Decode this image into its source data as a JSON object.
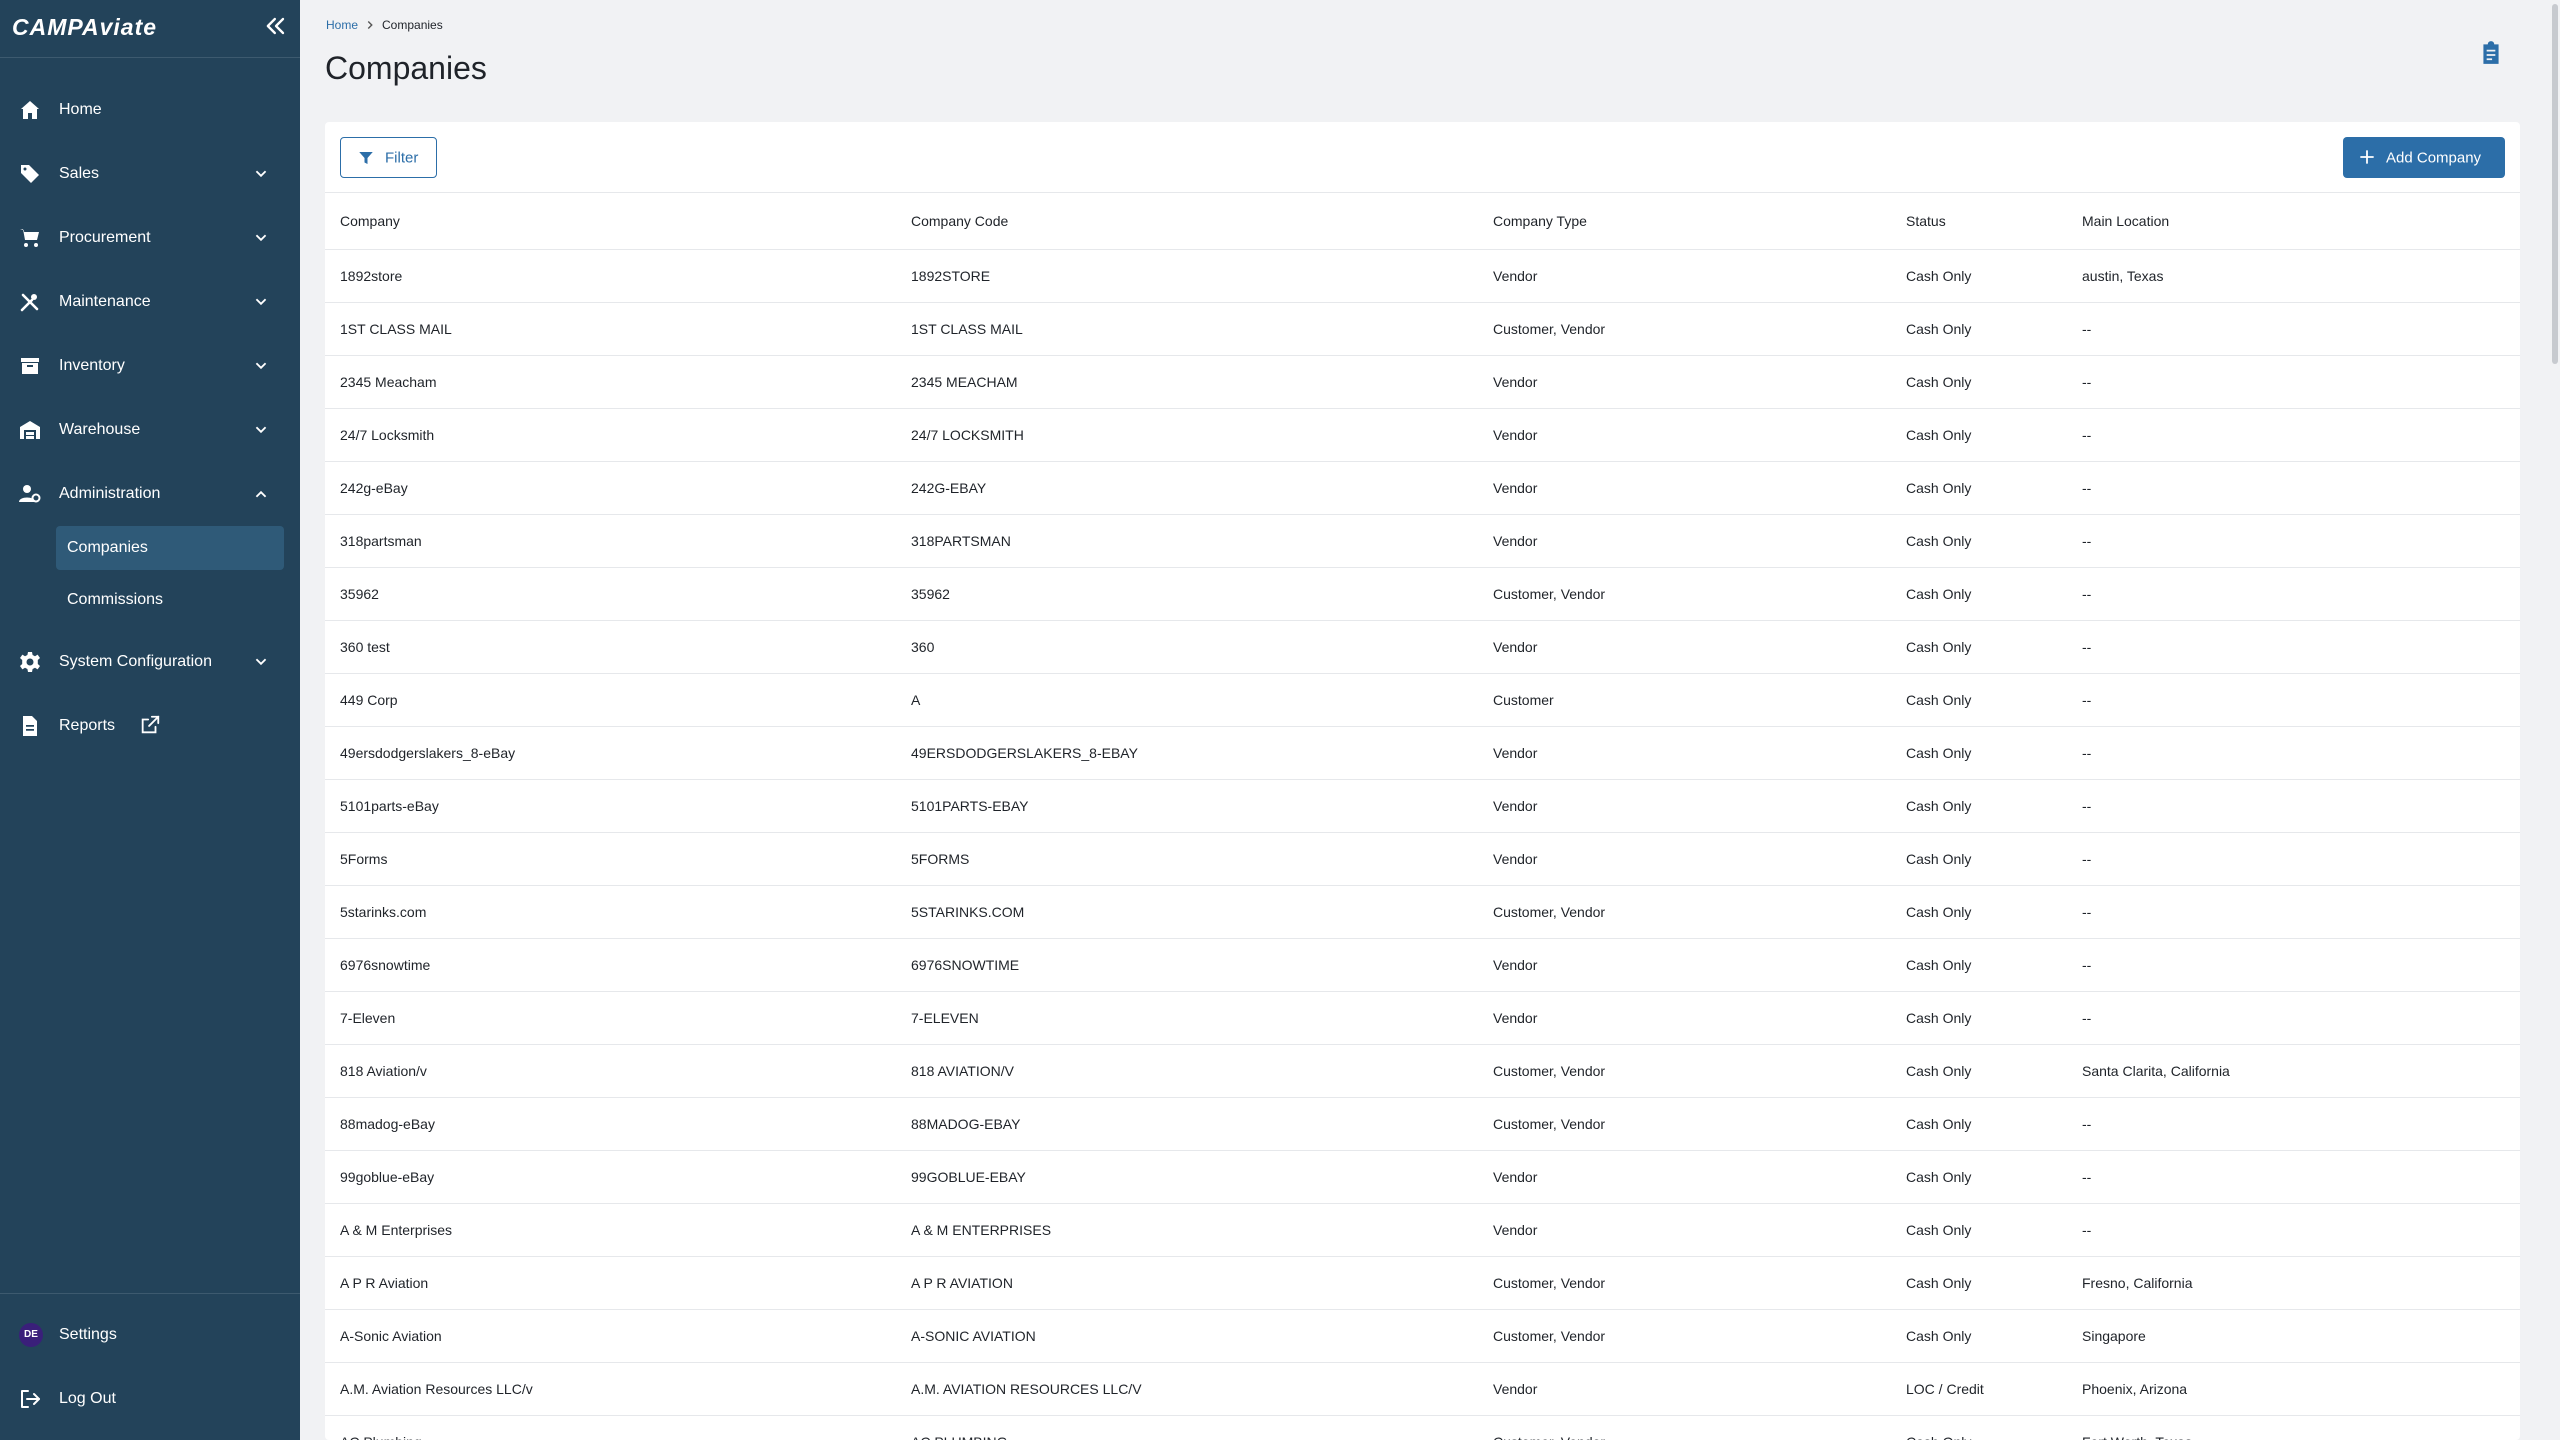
{
  "sidebar": {
    "logo": "CAMPAviate",
    "items": [
      {
        "label": "Home",
        "icon": "home-icon",
        "has_children": false
      },
      {
        "label": "Sales",
        "icon": "tag-icon",
        "has_children": true
      },
      {
        "label": "Procurement",
        "icon": "cart-icon",
        "has_children": true
      },
      {
        "label": "Maintenance",
        "icon": "tools-icon",
        "has_children": true
      },
      {
        "label": "Inventory",
        "icon": "archive-icon",
        "has_children": true
      },
      {
        "label": "Warehouse",
        "icon": "warehouse-icon",
        "has_children": true
      },
      {
        "label": "Administration",
        "icon": "admin-icon",
        "has_children": true,
        "expanded": true,
        "children": [
          {
            "label": "Companies",
            "active": true
          },
          {
            "label": "Commissions",
            "active": false
          }
        ]
      },
      {
        "label": "System Configuration",
        "icon": "gear-icon",
        "has_children": true
      },
      {
        "label": "Reports",
        "icon": "document-icon",
        "external": true
      }
    ],
    "bottom": [
      {
        "label": "Settings",
        "avatar_initials": "DE"
      },
      {
        "label": "Log Out",
        "icon": "logout-icon"
      }
    ]
  },
  "breadcrumb": {
    "home": "Home",
    "current": "Companies"
  },
  "page_title": "Companies",
  "toolbar": {
    "filter_label": "Filter",
    "add_label": "Add Company"
  },
  "table": {
    "headers": [
      "Company",
      "Company Code",
      "Company Type",
      "Status",
      "Main Location"
    ],
    "rows": [
      [
        "1892store",
        "1892STORE",
        "Vendor",
        "Cash Only",
        "austin, Texas"
      ],
      [
        "1ST CLASS MAIL",
        "1ST CLASS MAIL",
        "Customer, Vendor",
        "Cash Only",
        "--"
      ],
      [
        "2345 Meacham",
        "2345 MEACHAM",
        "Vendor",
        "Cash Only",
        "--"
      ],
      [
        "24/7 Locksmith",
        "24/7 LOCKSMITH",
        "Vendor",
        "Cash Only",
        "--"
      ],
      [
        "242g-eBay",
        "242G-EBAY",
        "Vendor",
        "Cash Only",
        "--"
      ],
      [
        "318partsman",
        "318PARTSMAN",
        "Vendor",
        "Cash Only",
        "--"
      ],
      [
        "35962",
        "35962",
        "Customer, Vendor",
        "Cash Only",
        "--"
      ],
      [
        "360 test",
        "360",
        "Vendor",
        "Cash Only",
        "--"
      ],
      [
        "449 Corp",
        "A",
        "Customer",
        "Cash Only",
        "--"
      ],
      [
        "49ersdodgerslakers_8-eBay",
        "49ERSDODGERSLAKERS_8-EBAY",
        "Vendor",
        "Cash Only",
        "--"
      ],
      [
        "5101parts-eBay",
        "5101PARTS-EBAY",
        "Vendor",
        "Cash Only",
        "--"
      ],
      [
        "5Forms",
        "5FORMS",
        "Vendor",
        "Cash Only",
        "--"
      ],
      [
        "5starinks.com",
        "5STARINKS.COM",
        "Customer, Vendor",
        "Cash Only",
        "--"
      ],
      [
        "6976snowtime",
        "6976SNOWTIME",
        "Vendor",
        "Cash Only",
        "--"
      ],
      [
        "7-Eleven",
        "7-ELEVEN",
        "Vendor",
        "Cash Only",
        "--"
      ],
      [
        "818 Aviation/v",
        "818 AVIATION/V",
        "Customer, Vendor",
        "Cash Only",
        "Santa Clarita, California"
      ],
      [
        "88madog-eBay",
        "88MADOG-EBAY",
        "Customer, Vendor",
        "Cash Only",
        "--"
      ],
      [
        "99goblue-eBay",
        "99GOBLUE-EBAY",
        "Vendor",
        "Cash Only",
        "--"
      ],
      [
        "A & M Enterprises",
        "A & M ENTERPRISES",
        "Vendor",
        "Cash Only",
        "--"
      ],
      [
        "A P R Aviation",
        "A P R AVIATION",
        "Customer, Vendor",
        "Cash Only",
        "Fresno, California"
      ],
      [
        "A-Sonic Aviation",
        "A-SONIC AVIATION",
        "Customer, Vendor",
        "Cash Only",
        "Singapore"
      ],
      [
        "A.M. Aviation Resources LLC/v",
        "A.M. AVIATION RESOURCES LLC/V",
        "Vendor",
        "LOC / Credit",
        "Phoenix, Arizona"
      ],
      [
        "AC Plumbing",
        "AC PLUMBING",
        "Customer, Vendor",
        "Cash Only",
        "Fort Worth, Texas"
      ]
    ]
  },
  "colors": {
    "sidebar_bg": "#23435a",
    "accent": "#2c6ea8",
    "active_item": "#2f5a78"
  }
}
